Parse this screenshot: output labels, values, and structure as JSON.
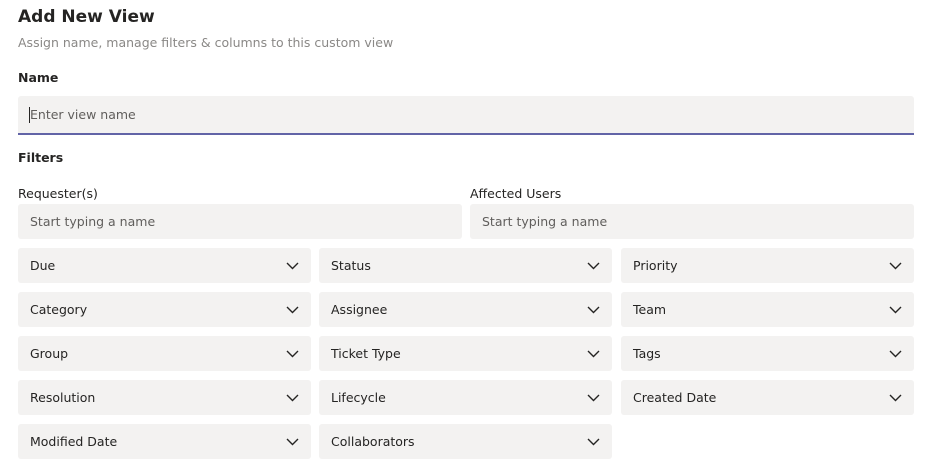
{
  "header": {
    "title": "Add New View",
    "subtitle": "Assign name, manage filters & columns to this custom view"
  },
  "name_section": {
    "label": "Name",
    "placeholder": "Enter view name",
    "value": ""
  },
  "filters": {
    "label": "Filters",
    "requesters": {
      "label": "Requester(s)",
      "placeholder": "Start typing a name"
    },
    "affected_users": {
      "label": "Affected Users",
      "placeholder": "Start typing a name"
    },
    "dropdowns": [
      {
        "label": "Due",
        "icon": "chevron-down-icon"
      },
      {
        "label": "Status",
        "icon": "chevron-down-icon"
      },
      {
        "label": "Priority",
        "icon": "chevron-down-icon"
      },
      {
        "label": "Category",
        "icon": "chevron-down-icon"
      },
      {
        "label": "Assignee",
        "icon": "chevron-down-icon"
      },
      {
        "label": "Team",
        "icon": "chevron-down-icon"
      },
      {
        "label": "Group",
        "icon": "chevron-down-icon"
      },
      {
        "label": "Ticket Type",
        "icon": "chevron-down-icon"
      },
      {
        "label": "Tags",
        "icon": "chevron-down-icon"
      },
      {
        "label": "Resolution",
        "icon": "chevron-down-icon"
      },
      {
        "label": "Lifecycle",
        "icon": "chevron-down-icon"
      },
      {
        "label": "Created Date",
        "icon": "chevron-down-icon"
      },
      {
        "label": "Modified Date",
        "icon": "chevron-down-icon"
      },
      {
        "label": "Collaborators",
        "icon": "chevron-down-icon"
      }
    ]
  },
  "colors": {
    "accent": "#6264a7",
    "field_background": "#f3f2f1",
    "subtitle_text": "#8a8886"
  }
}
